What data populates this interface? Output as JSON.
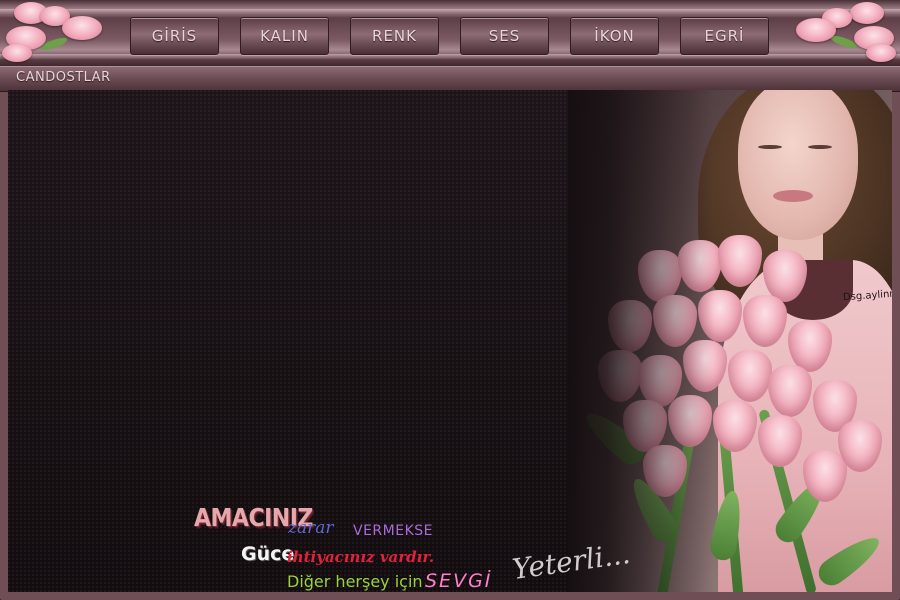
{
  "nav": {
    "items": [
      {
        "label": "GİRİS"
      },
      {
        "label": "KALIN"
      },
      {
        "label": "RENK"
      },
      {
        "label": "SES"
      },
      {
        "label": "İKON"
      },
      {
        "label": "EGRİ"
      }
    ]
  },
  "site": {
    "name": "CANDOSTLAR"
  },
  "photo": {
    "signature": "Dsg.aylinnnn"
  },
  "quote": {
    "line1_a": "AMACINIZ",
    "line1_b": "zarar",
    "line1_c": "VERMEKSE",
    "line2_a": "Güce",
    "line2_b": "ihtiyacınız vardır.",
    "line3_a": "Diğer herşey için",
    "line3_b": "SEVGİ",
    "line3_c": "Yeterli..."
  },
  "colors": {
    "frame": "#6f4e56",
    "background": "#1a1216",
    "button_text": "#ead5da"
  }
}
